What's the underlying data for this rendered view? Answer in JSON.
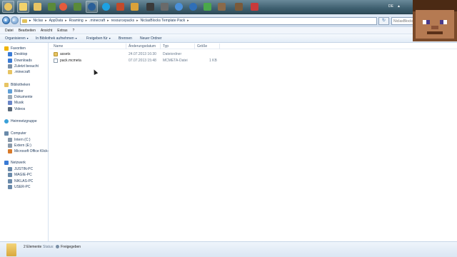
{
  "taskbar": {
    "tray_lang": "DE",
    "tray_arrow": "▲",
    "buttons": [
      {
        "icon": "start-orb-icon",
        "color": "#e7c463"
      },
      {
        "icon": "windows-explorer-icon",
        "color": "#f2d36b"
      },
      {
        "icon": "chrome-icon",
        "color": "#e55b3c"
      },
      {
        "icon": "minecraft-icon",
        "color": "#5a8a3a"
      },
      {
        "icon": "steam-icon",
        "color": "#2a5f98"
      },
      {
        "icon": "skype-icon",
        "color": "#1da1e2"
      },
      {
        "icon": "app-icon",
        "color": "#c24a2a"
      },
      {
        "icon": "app-icon",
        "color": "#d9a23a"
      },
      {
        "icon": "video-icon",
        "color": "#3a3a3a"
      },
      {
        "icon": "globe-icon",
        "color": "#4a90d9"
      },
      {
        "icon": "globe-icon",
        "color": "#2f6fb8"
      },
      {
        "icon": "chart-icon",
        "color": "#4aa84a"
      },
      {
        "icon": "brush-icon",
        "color": "#8a6a4a"
      },
      {
        "icon": "block-icon",
        "color": "#7a5a3a"
      },
      {
        "icon": "flag-icon",
        "color": "#c83a3a"
      }
    ]
  },
  "address": {
    "crumbs": [
      "Niclas",
      "AppData",
      "Roaming",
      ".minecraft",
      "resourcepacks",
      "NiclasBlocks Template Pack"
    ],
    "separator": "▸",
    "search_placeholder": "NiclasBlocks Template..."
  },
  "menubar": [
    "Datei",
    "Bearbeiten",
    "Ansicht",
    "Extras",
    "?"
  ],
  "commands": {
    "organize": "Organisieren",
    "include": "In Bibliothek aufnehmen",
    "share": "Freigeben für",
    "burn": "Brennen",
    "new_folder": "Neuer Ordner",
    "caret": "▾"
  },
  "navpane": {
    "favorites": {
      "label": "Favoriten",
      "icon": "star-icon",
      "color": "#f0b400"
    },
    "favorite_items": [
      {
        "label": "Desktop",
        "icon": "desktop-icon",
        "color": "#3a7bd5"
      },
      {
        "label": "Downloads",
        "icon": "downloads-icon",
        "color": "#3a7bd5"
      },
      {
        "label": "Zuletzt besucht",
        "icon": "recent-icon",
        "color": "#7a8fa6"
      },
      {
        "label": ".minecraft",
        "icon": "folder-icon",
        "color": "#e7c463"
      }
    ],
    "libraries": {
      "label": "Bibliotheken",
      "icon": "library-icon",
      "color": "#e7c463"
    },
    "library_items": [
      {
        "label": "Bilder",
        "icon": "pictures-icon",
        "color": "#5fa0d8"
      },
      {
        "label": "Dokumente",
        "icon": "documents-icon",
        "color": "#9aa9b8"
      },
      {
        "label": "Musik",
        "icon": "music-icon",
        "color": "#6a86c8"
      },
      {
        "label": "Videos",
        "icon": "videos-icon",
        "color": "#5a6a7a"
      }
    ],
    "homegroup": {
      "label": "Heimnetzgruppe",
      "icon": "homegroup-icon",
      "color": "#3aa0d8"
    },
    "computer": {
      "label": "Computer",
      "icon": "computer-icon",
      "color": "#6a8aaa"
    },
    "computer_items": [
      {
        "label": "Intern (C:)",
        "icon": "drive-icon",
        "color": "#8a9aab"
      },
      {
        "label": "Extern (E:)",
        "icon": "drive-icon",
        "color": "#8a9aab"
      },
      {
        "label": "Microsoft Office Klick-",
        "icon": "drive-icon",
        "color": "#d87a2a"
      }
    ],
    "network": {
      "label": "Netzwerk",
      "icon": "network-icon",
      "color": "#3a7bd5"
    },
    "network_items": [
      {
        "label": "JUSTIN-PC",
        "icon": "pc-icon",
        "color": "#6a8aaa"
      },
      {
        "label": "MAGIE-PC",
        "icon": "pc-icon",
        "color": "#6a8aaa"
      },
      {
        "label": "NIKLAS-PC",
        "icon": "pc-icon",
        "color": "#6a8aaa"
      },
      {
        "label": "USER-PC",
        "icon": "pc-icon",
        "color": "#6a8aaa"
      }
    ]
  },
  "list": {
    "columns": [
      "Name",
      "Änderungsdatum",
      "Typ",
      "Größe"
    ],
    "rows": [
      {
        "name": "assets",
        "date": "24.07.2013 16:30",
        "type": "Dateiordner",
        "size": "",
        "icon": "folder-icon"
      },
      {
        "name": "pack.mcmeta",
        "date": "07.07.2013 15:48",
        "type": "MCMETA-Datei",
        "size": "1 KB",
        "icon": "file-icon"
      }
    ]
  },
  "details": {
    "count": "2 Elemente",
    "status_label": "Status:",
    "share_state": "Freigegeben"
  },
  "colors": {
    "accent": "#3a7bd5",
    "text": "#1e395b"
  }
}
